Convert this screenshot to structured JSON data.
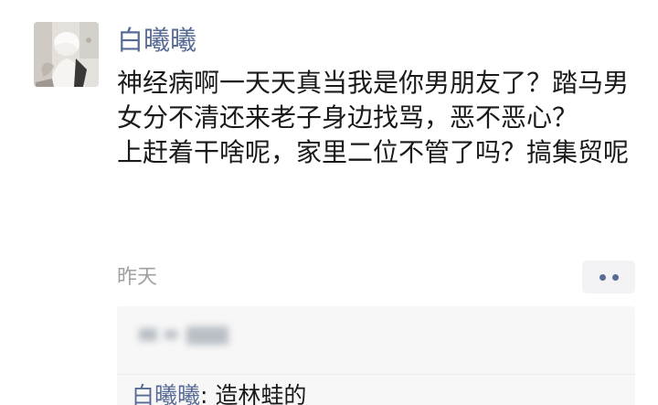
{
  "post": {
    "author_name": "白曦曦",
    "body_paragraphs": [
      "神经病啊一天天真当我是你男朋友了？踏马男女分不清还来老子身边找骂，恶不恶心？",
      "上赶着干啥呢，家里二位不管了吗？搞集贸呢"
    ],
    "timestamp": "昨天",
    "more_icon": "ellipsis-icon"
  },
  "comments": {
    "likes_redacted": true,
    "items": [
      {
        "author": "白曦曦",
        "separator": ": ",
        "text": "造林蛙的"
      }
    ]
  },
  "colors": {
    "name_link": "#576b95",
    "body_text": "#1a1a1a",
    "timestamp": "#a0a0a0",
    "comment_bg": "#f7f7f7"
  }
}
